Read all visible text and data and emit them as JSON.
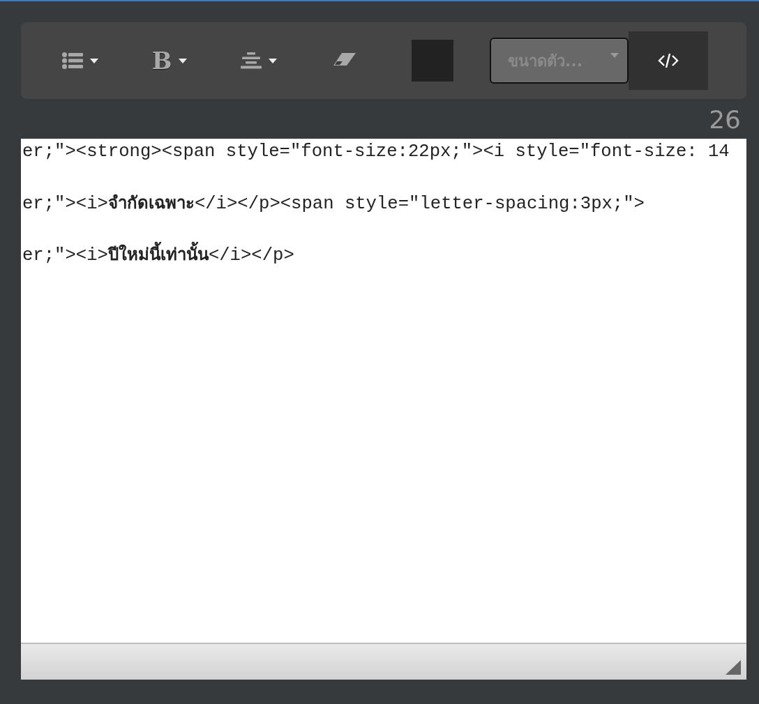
{
  "toolbar": {
    "buttons": [
      {
        "kind": "list",
        "dropdown": true
      },
      {
        "kind": "bold",
        "label": "B",
        "dropdown": true
      },
      {
        "kind": "align",
        "dropdown": true
      },
      {
        "kind": "eraser",
        "dropdown": false
      }
    ],
    "font_size": {
      "placeholder": "ขนาดตัว..."
    },
    "code_view": {
      "active": true
    }
  },
  "char_count": "26",
  "editor": {
    "lines": [
      "er;\"><strong><span style=\"font-size:22px;\"><i style=\"font-size: 14",
      "er;\"><i>**จำกัดเฉพาะ**</i></p><span style=\"letter-spacing:3px;\">",
      "er;\"><i>**ปีใหม่นี้เท่านั้น**</i></p>"
    ]
  }
}
